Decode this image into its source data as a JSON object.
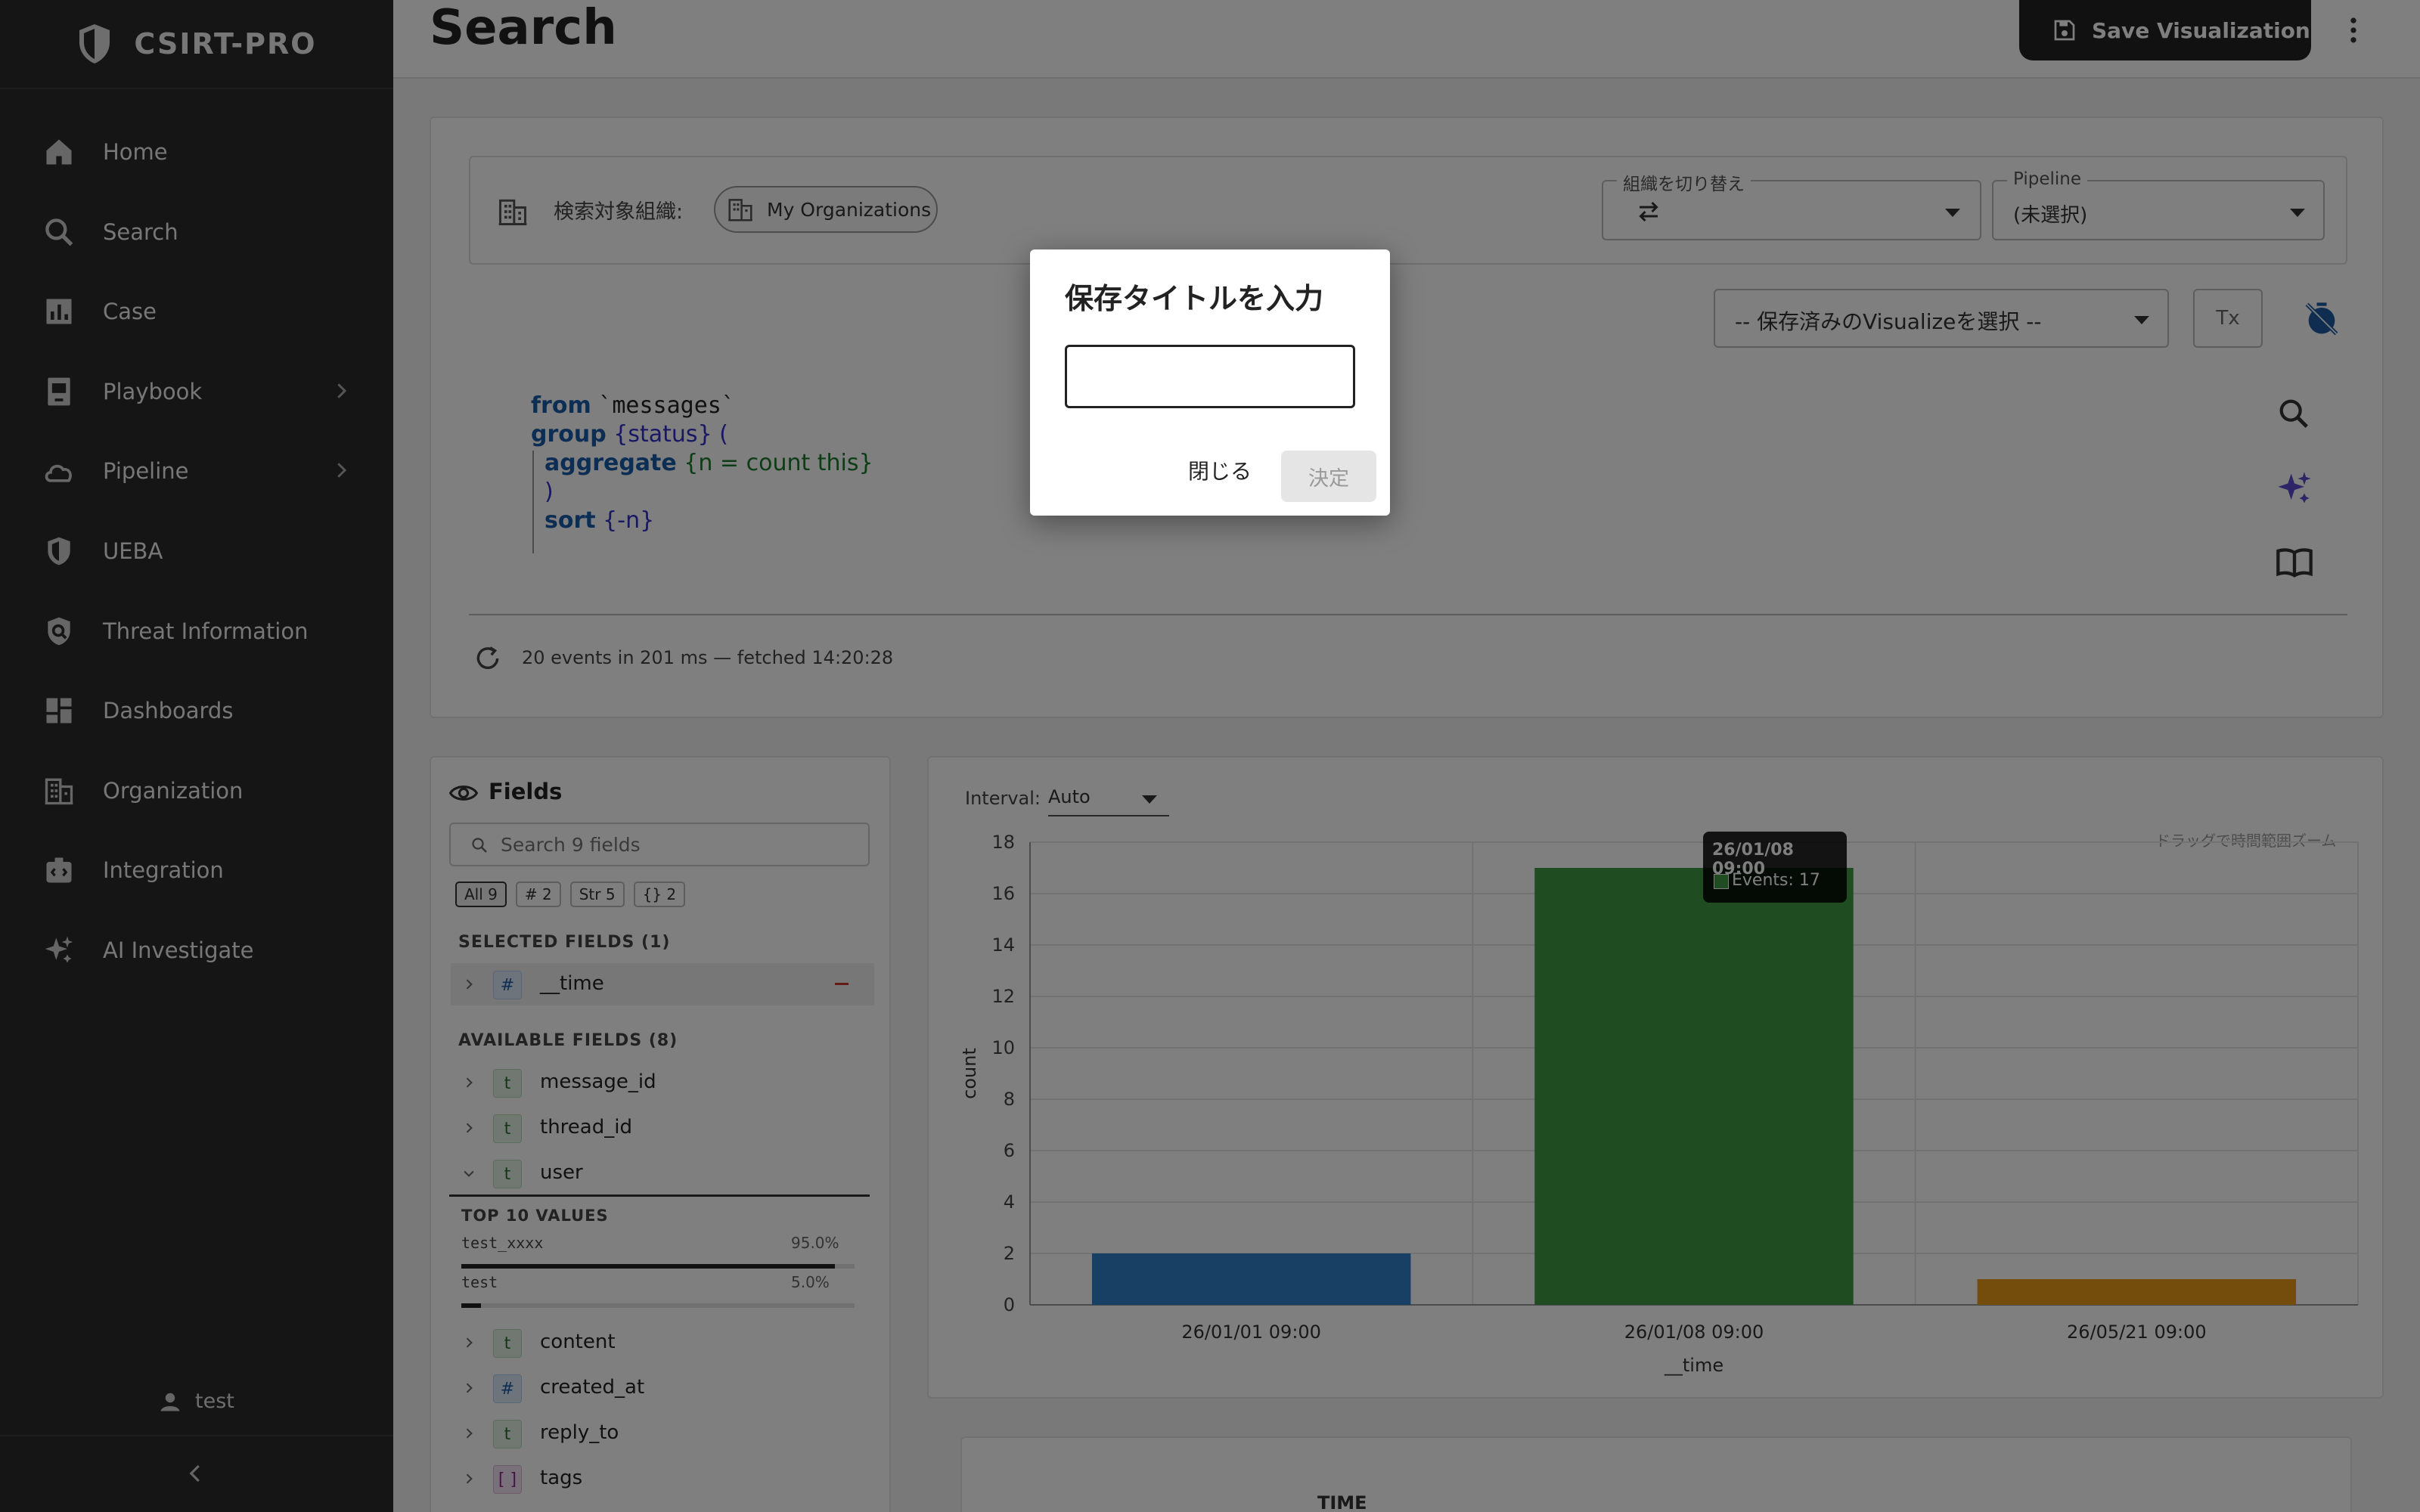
{
  "app": {
    "brand": "CSIRT-PRO"
  },
  "sidebar": {
    "items": [
      {
        "label": "Home",
        "icon": "home-icon"
      },
      {
        "label": "Search",
        "icon": "search-icon"
      },
      {
        "label": "Case",
        "icon": "chart-icon"
      },
      {
        "label": "Playbook",
        "icon": "book-icon",
        "has_children": true
      },
      {
        "label": "Pipeline",
        "icon": "cloud-icon",
        "has_children": true
      },
      {
        "label": "UEBA",
        "icon": "shield-icon"
      },
      {
        "label": "Threat Information",
        "icon": "shield-search-icon"
      },
      {
        "label": "Dashboards",
        "icon": "dashboard-icon"
      },
      {
        "label": "Organization",
        "icon": "building-icon"
      },
      {
        "label": "Integration",
        "icon": "integration-icon"
      },
      {
        "label": "AI Investigate",
        "icon": "sparkle-icon"
      }
    ],
    "user": "test"
  },
  "header": {
    "title": "Search",
    "save_label": "Save Visualization"
  },
  "query": {
    "org_label": "検索対象組織:",
    "org_chip": "My Organizations",
    "switch_legend": "組織を切り替え",
    "pipeline_legend": "Pipeline",
    "pipeline_value": "(未選択)",
    "saved_viz_placeholder": "-- 保存済みのVisualizeを選択 --",
    "format_button": "Tx",
    "code": {
      "line1_kw": "from",
      "line1_rest": "`messages`",
      "line2_kw": "group",
      "line2_rest": "{status}",
      "line2_paren": "(",
      "line3_kw": "aggregate",
      "line3_rest": "{n = count this}",
      "line4": ")",
      "line5_kw": "sort",
      "line5_rest": "{-n}"
    },
    "status": "20 events in 201 ms — fetched 14:20:28"
  },
  "fields": {
    "title": "Fields",
    "search_placeholder": "Search 9 fields",
    "filters": [
      {
        "label": "All 9",
        "active": true
      },
      {
        "label": "# 2"
      },
      {
        "label": "Str 5"
      },
      {
        "label": "{} 2"
      }
    ],
    "selected_heading": "SELECTED FIELDS (1)",
    "selected": [
      {
        "type": "#",
        "name": "__time"
      }
    ],
    "available_heading": "AVAILABLE FIELDS (8)",
    "available_top": [
      {
        "type": "t",
        "name": "message_id"
      },
      {
        "type": "t",
        "name": "thread_id"
      },
      {
        "type": "t",
        "name": "user",
        "expanded": true
      }
    ],
    "top_values_heading": "TOP 10 VALUES",
    "top_values": [
      {
        "value": "test_xxxx",
        "pct": "95.0%",
        "fraction": 0.95
      },
      {
        "value": "test",
        "pct": "5.0%",
        "fraction": 0.05
      }
    ],
    "available_rest": [
      {
        "type": "t",
        "name": "content"
      },
      {
        "type": "#",
        "name": "created_at"
      },
      {
        "type": "t",
        "name": "reply_to"
      },
      {
        "type": "[ ]",
        "name": "tags"
      }
    ]
  },
  "chart": {
    "interval_label": "Interval:",
    "interval_value": "Auto",
    "hint": "ドラッグで時間範囲ズーム",
    "tooltip_title": "26/01/08 09:00",
    "tooltip_value": "Events: 17"
  },
  "chart_data": {
    "type": "bar",
    "categories": [
      "26/01/01 09:00",
      "26/01/08 09:00",
      "26/05/21 09:00"
    ],
    "values": [
      2,
      17,
      1
    ],
    "colors": [
      "#2f80c8",
      "#3f9a42",
      "#e89a1a"
    ],
    "xlabel": "__time",
    "ylabel": "count",
    "ylim": [
      0,
      18
    ],
    "yticks": [
      0,
      2,
      4,
      6,
      8,
      10,
      12,
      14,
      16,
      18
    ],
    "grid": true
  },
  "table": {
    "time_header": "TIME"
  },
  "dialog": {
    "title": "保存タイトルを入力",
    "input_value": "",
    "close_label": "閉じる",
    "confirm_label": "決定"
  }
}
